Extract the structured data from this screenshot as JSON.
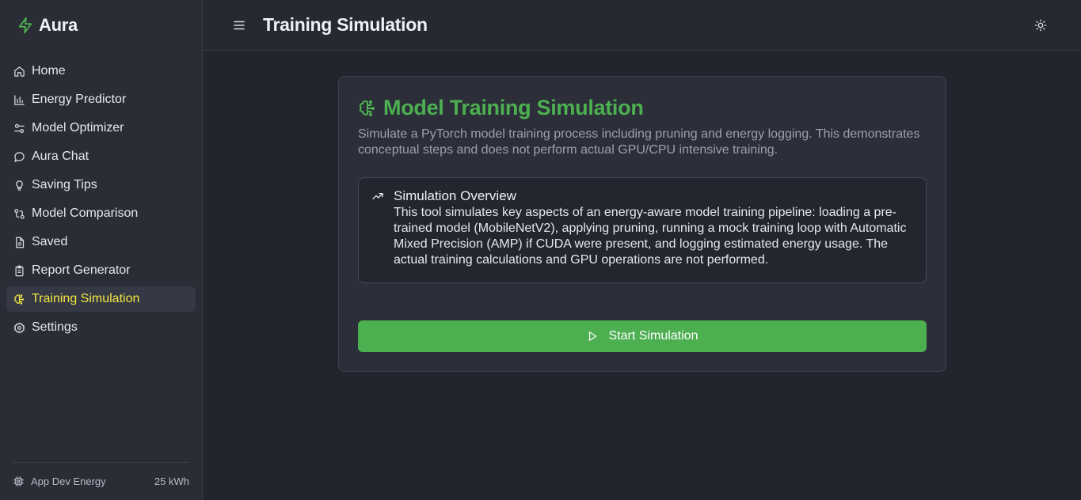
{
  "app": {
    "brand": "Aura",
    "accent": "#4caf50",
    "active_color": "#f5e642"
  },
  "sidebar": {
    "items": [
      {
        "label": "Home",
        "icon": "home-icon"
      },
      {
        "label": "Energy Predictor",
        "icon": "bar-chart-icon"
      },
      {
        "label": "Model Optimizer",
        "icon": "sliders-icon"
      },
      {
        "label": "Aura Chat",
        "icon": "chat-bubble-icon"
      },
      {
        "label": "Saving Tips",
        "icon": "lightbulb-icon"
      },
      {
        "label": "Model Comparison",
        "icon": "compare-icon"
      },
      {
        "label": "Saved",
        "icon": "document-icon"
      },
      {
        "label": "Report Generator",
        "icon": "clipboard-icon"
      },
      {
        "label": "Training Simulation",
        "icon": "brain-circuit-icon",
        "active": true
      },
      {
        "label": "Settings",
        "icon": "gear-icon"
      }
    ],
    "footer": {
      "label": "App Dev Energy",
      "value": "25 kWh",
      "icon": "cpu-icon"
    }
  },
  "header": {
    "title": "Training Simulation",
    "menu_icon": "menu-icon",
    "theme_icon": "sun-icon"
  },
  "card": {
    "title": "Model Training Simulation",
    "description": "Simulate a PyTorch model training process including pruning and energy logging. This demonstrates conceptual steps and does not perform actual GPU/CPU intensive training.",
    "overview": {
      "title": "Simulation Overview",
      "text": "This tool simulates key aspects of an energy-aware model training pipeline: loading a pre-trained model (MobileNetV2), applying pruning, running a mock training loop with Automatic Mixed Precision (AMP) if CUDA were present, and logging estimated energy usage. The actual training calculations and GPU operations are not performed.",
      "icon": "trending-up-icon"
    },
    "start_button": "Start Simulation"
  }
}
